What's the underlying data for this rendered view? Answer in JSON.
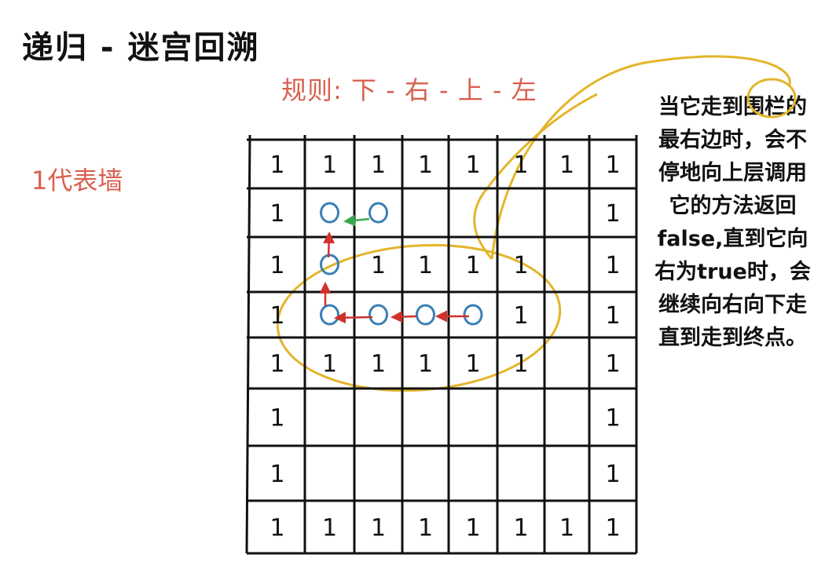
{
  "title": "递归 - 迷宫回溯",
  "rule": "规则: 下 - 右 - 上 - 左",
  "legend": "1代表墙",
  "note_lines": [
    "当它走到围栏的",
    "最右边时，会不",
    "停地向上层调用",
    "它的方法返回",
    "false,直到它向",
    "右为true时，会",
    "继续向右向下走",
    "直到走到终点。"
  ],
  "wall_mark": "1",
  "maze": [
    [
      1,
      1,
      1,
      1,
      1,
      1,
      1,
      1
    ],
    [
      1,
      0,
      0,
      0,
      0,
      0,
      0,
      1
    ],
    [
      1,
      0,
      1,
      1,
      1,
      1,
      0,
      1
    ],
    [
      1,
      0,
      0,
      0,
      0,
      1,
      0,
      1
    ],
    [
      1,
      1,
      1,
      1,
      1,
      1,
      0,
      1
    ],
    [
      1,
      0,
      0,
      0,
      0,
      0,
      0,
      1
    ],
    [
      1,
      0,
      0,
      0,
      0,
      0,
      0,
      1
    ],
    [
      1,
      1,
      1,
      1,
      1,
      1,
      1,
      1
    ]
  ],
  "path_circles": [
    {
      "row": 1,
      "col": 1
    },
    {
      "row": 1,
      "col": 2
    },
    {
      "row": 2,
      "col": 1
    },
    {
      "row": 3,
      "col": 1
    },
    {
      "row": 3,
      "col": 2
    },
    {
      "row": 3,
      "col": 3
    },
    {
      "row": 3,
      "col": 4
    }
  ],
  "colors": {
    "wall_ink": "#111111",
    "circle": "#3a7fb5",
    "arrow_red": "#d0312d",
    "arrow_green": "#3aa84a",
    "highlight": "#e3b52b",
    "rule_text": "#d9604f"
  }
}
